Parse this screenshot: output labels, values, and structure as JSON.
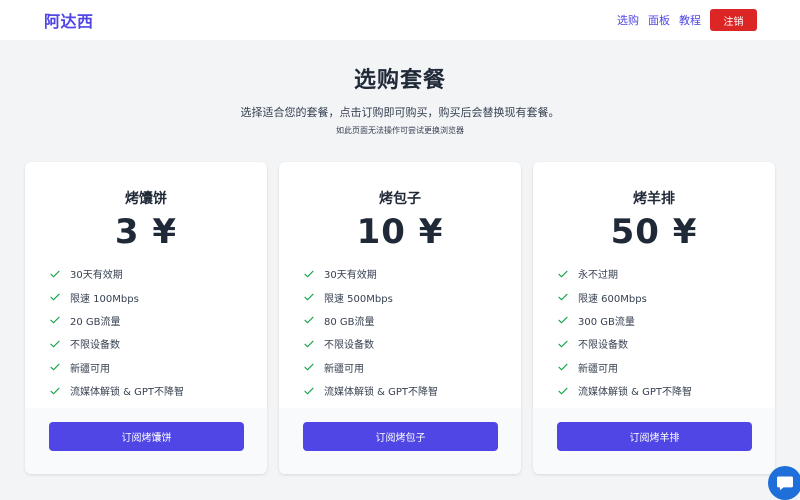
{
  "navbar": {
    "brand": "阿达西",
    "links": [
      "选购",
      "面板",
      "教程"
    ],
    "logout_label": "注销"
  },
  "hero": {
    "title": "选购套餐",
    "subtitle": "选择适合您的套餐，点击订购即可购买，购买后会替换现有套餐。",
    "note": "如此页面无法操作可尝试更换浏览器"
  },
  "plans": [
    {
      "name": "烤馕饼",
      "price": "3 ¥",
      "features": [
        "30天有效期",
        "限速 100Mbps",
        "20 GB流量",
        "不限设备数",
        "新疆可用",
        "流媒体解锁 & GPT不降智"
      ],
      "button_label": "订阅烤馕饼"
    },
    {
      "name": "烤包子",
      "price": "10 ¥",
      "features": [
        "30天有效期",
        "限速 500Mbps",
        "80 GB流量",
        "不限设备数",
        "新疆可用",
        "流媒体解锁 & GPT不降智"
      ],
      "button_label": "订阅烤包子"
    },
    {
      "name": "烤羊排",
      "price": "50 ¥",
      "features": [
        "永不过期",
        "限速 600Mbps",
        "300 GB流量",
        "不限设备数",
        "新疆可用",
        "流媒体解锁 & GPT不降智"
      ],
      "button_label": "订阅烤羊排"
    }
  ],
  "colors": {
    "accent": "#4f46e5",
    "danger": "#dc2626",
    "check": "#16a34a",
    "chat": "#1e6fd9"
  },
  "icons": {
    "feature": "check-icon",
    "chat": "chat-bubble-icon"
  }
}
